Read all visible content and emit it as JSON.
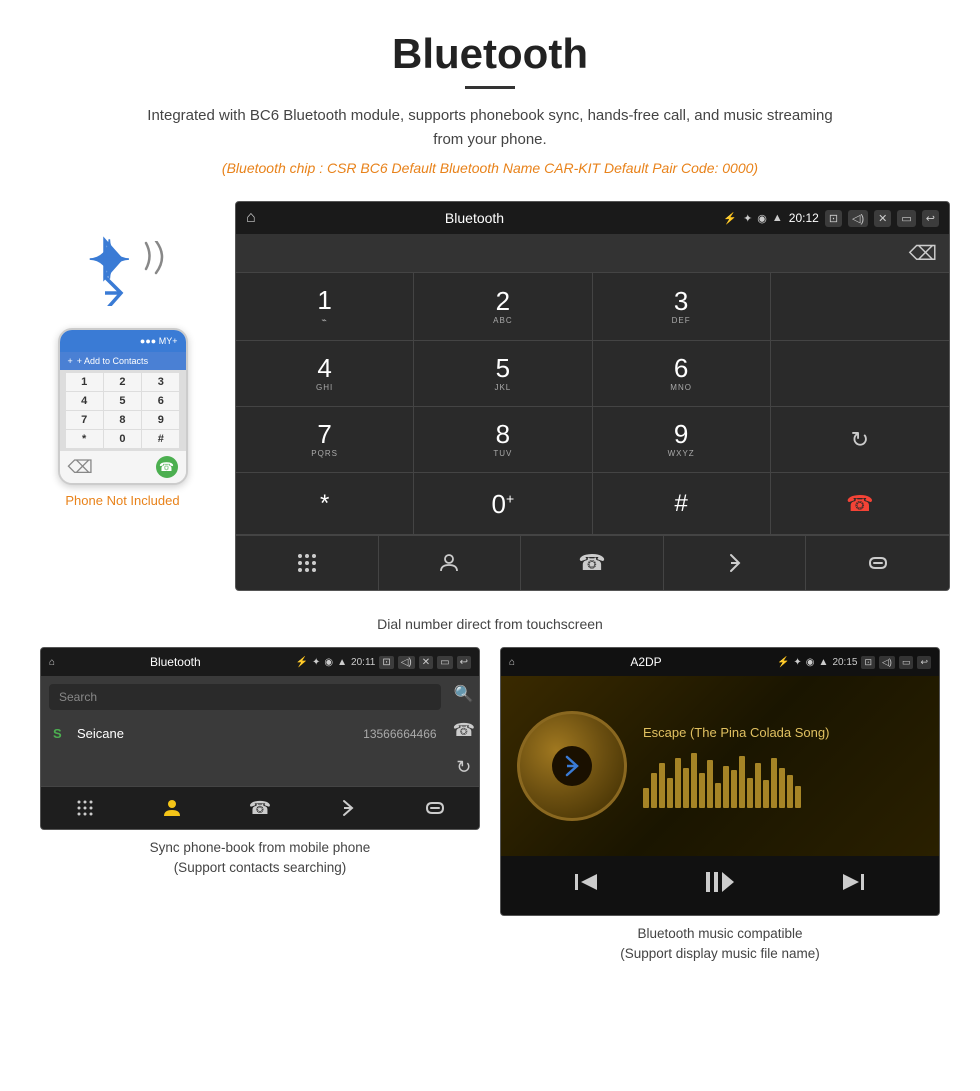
{
  "page": {
    "title": "Bluetooth",
    "description": "Integrated with BC6 Bluetooth module, supports phonebook sync, hands-free call, and music streaming from your phone.",
    "specs": "(Bluetooth chip : CSR BC6    Default Bluetooth Name CAR-KIT    Default Pair Code: 0000)"
  },
  "dialer": {
    "status_bar": {
      "title": "Bluetooth",
      "time": "20:12"
    },
    "keys": [
      {
        "main": "1",
        "sub": ""
      },
      {
        "main": "2",
        "sub": "ABC"
      },
      {
        "main": "3",
        "sub": "DEF"
      },
      {
        "main": "",
        "sub": ""
      },
      {
        "main": "4",
        "sub": "GHI"
      },
      {
        "main": "5",
        "sub": "JKL"
      },
      {
        "main": "6",
        "sub": "MNO"
      },
      {
        "main": "",
        "sub": ""
      },
      {
        "main": "7",
        "sub": "PQRS"
      },
      {
        "main": "8",
        "sub": "TUV"
      },
      {
        "main": "9",
        "sub": "WXYZ"
      },
      {
        "main": "",
        "sub": ""
      },
      {
        "main": "*",
        "sub": ""
      },
      {
        "main": "0",
        "sub": "+"
      },
      {
        "main": "#",
        "sub": ""
      },
      {
        "main": "",
        "sub": ""
      }
    ],
    "caption": "Dial number direct from touchscreen"
  },
  "phonebook": {
    "status_bar": {
      "title": "Bluetooth",
      "time": "20:11"
    },
    "search_placeholder": "Search",
    "contact": {
      "letter": "S",
      "name": "Seicane",
      "phone": "13566664466"
    },
    "caption_line1": "Sync phone-book from mobile phone",
    "caption_line2": "(Support contacts searching)"
  },
  "music": {
    "status_bar": {
      "title": "A2DP",
      "time": "20:15"
    },
    "song_title": "Escape (The Pina Colada Song)",
    "caption_line1": "Bluetooth music compatible",
    "caption_line2": "(Support display music file name)"
  },
  "phone_mockup": {
    "label": "Phone Not Included",
    "action_bar_text": "+ Add to Contacts",
    "keys": [
      "1",
      "2",
      "3",
      "4",
      "5",
      "6",
      "7",
      "8",
      "9",
      "*",
      "0",
      "#"
    ]
  }
}
